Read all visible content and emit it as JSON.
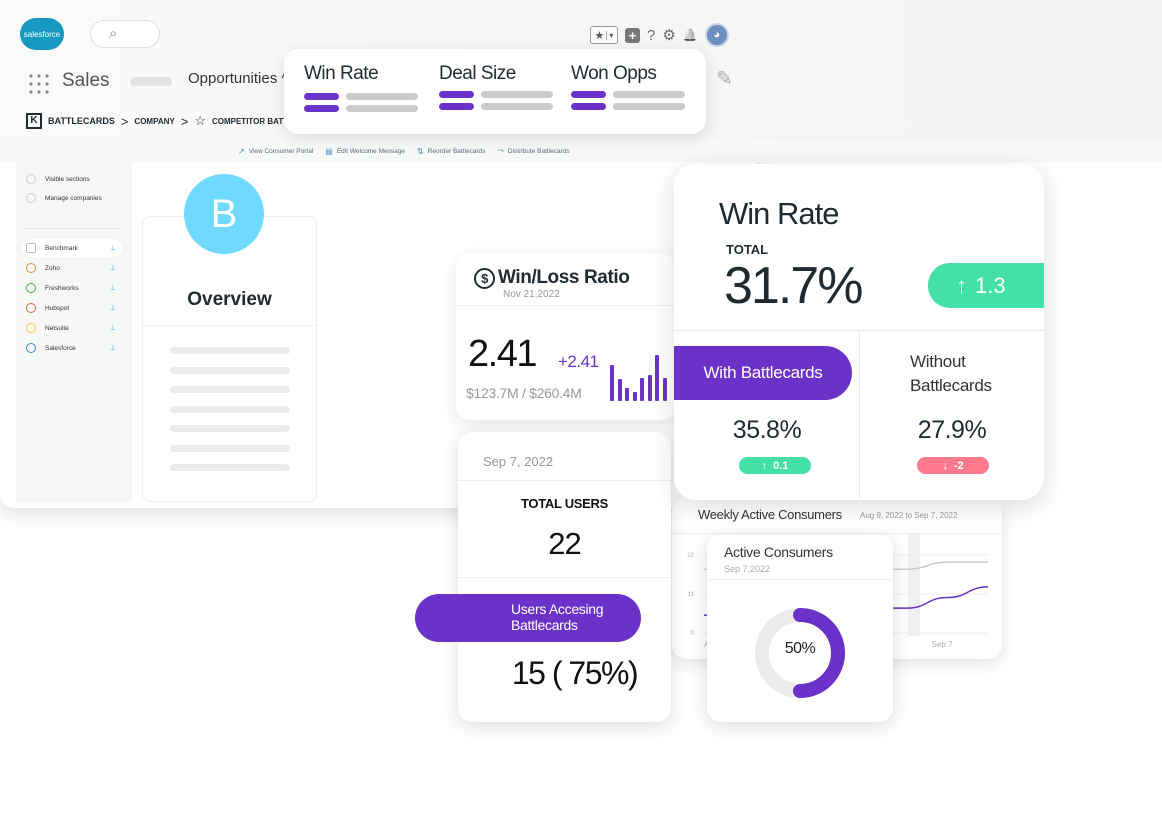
{
  "salesforce": {
    "logo_text": "salesforce",
    "search_icon": "search-icon",
    "app_name": "Sales",
    "nav_active": "Opportunities",
    "nav_chevron": "^",
    "toolbar_icons": [
      "favorites-star-icon",
      "add-icon",
      "help-icon",
      "settings-gear-icon",
      "notifications-bell-icon",
      "user-avatar"
    ],
    "glyphs": {
      "star": "★",
      "caret": "▾",
      "plus": "+",
      "help": "?",
      "gear": "⚙",
      "bell": "🔔",
      "pencil": "✎",
      "search": "⌕"
    }
  },
  "breadcrumb": {
    "logo": "K",
    "items": [
      "BATTLECARDS",
      "COMPANY",
      "COMPETITOR BATTLECARD"
    ],
    "separator": ">",
    "star": "☆"
  },
  "action_bar": [
    {
      "icon": "external-link-icon",
      "glyph": "↗",
      "label": "View Consumer Portal"
    },
    {
      "icon": "message-icon",
      "glyph": "▤",
      "label": "Edit Welcome Message"
    },
    {
      "icon": "reorder-icon",
      "glyph": "⇅",
      "label": "Reorder Battlecards"
    },
    {
      "icon": "distribute-icon",
      "glyph": "⤳",
      "label": "Distribute Battlecards"
    }
  ],
  "sidebar": {
    "top_items": [
      "Visible sections",
      "Manage companies"
    ],
    "companies": [
      {
        "label": "Benchmark",
        "color": "#bbbbbb",
        "active": true
      },
      {
        "label": "Zoho",
        "color": "#f08a3c"
      },
      {
        "label": "Freshworks",
        "color": "#4caf50"
      },
      {
        "label": "Hubspot",
        "color": "#f0633c"
      },
      {
        "label": "Netsuite",
        "color": "#f5c842"
      },
      {
        "label": "Salesforce",
        "color": "#3c8af0"
      }
    ],
    "pin_glyph": "⊥"
  },
  "overview": {
    "avatar_letter": "B",
    "title": "Overview"
  },
  "metric_tabs": [
    "Win Rate",
    "Deal Size",
    "Won Opps"
  ],
  "win_loss": {
    "title": "Win/Loss Ratio",
    "icon_glyph": "$",
    "date": "Nov 21,2022",
    "value": "2.41",
    "change": "+2.41",
    "subtitle": "$123.7M / $260.4M",
    "sparkline": [
      0.62,
      0.38,
      0.22,
      0.15,
      0.4,
      0.45,
      0.8,
      0.4
    ]
  },
  "users": {
    "date": "Sep 7, 2022",
    "total_label": "TOTAL USERS",
    "total": "22",
    "access_label": "Users Accesing Battlecards",
    "access_value": "15 ( 75%)"
  },
  "weekly": {
    "title": "Weekly Active Consumers",
    "range": "Aug 9, 2022 to Sep 7, 2022",
    "y_ticks": [
      "22",
      "11",
      "0"
    ],
    "x_ticks": [
      "A",
      "Sep 7"
    ],
    "series_total": [
      18,
      18,
      18,
      18,
      18,
      18,
      20,
      20
    ],
    "series_active": [
      5,
      5,
      6,
      6,
      7,
      7,
      10,
      13
    ]
  },
  "active_consumers": {
    "title": "Active Consumers",
    "date": "Sep 7,2022",
    "percent_label": "50%",
    "fraction": 0.5
  },
  "win_rate": {
    "title": "Win Rate",
    "total_label": "TOTAL",
    "value": "31.7%",
    "change": "1.3",
    "with_label": "With Battlecards",
    "without_label_1": "Without",
    "without_label_2": "Battlecards",
    "with_value": "35.8%",
    "without_value": "27.9%",
    "with_delta": "0.1",
    "without_delta": "-2",
    "up_glyph": "↑",
    "down_glyph": "↓"
  },
  "colors": {
    "purple": "#6a32c9",
    "green": "#45e0a8",
    "red": "#ff7a8e",
    "sky": "#6fd9ff",
    "salesforce_blue": "#1798c1"
  }
}
